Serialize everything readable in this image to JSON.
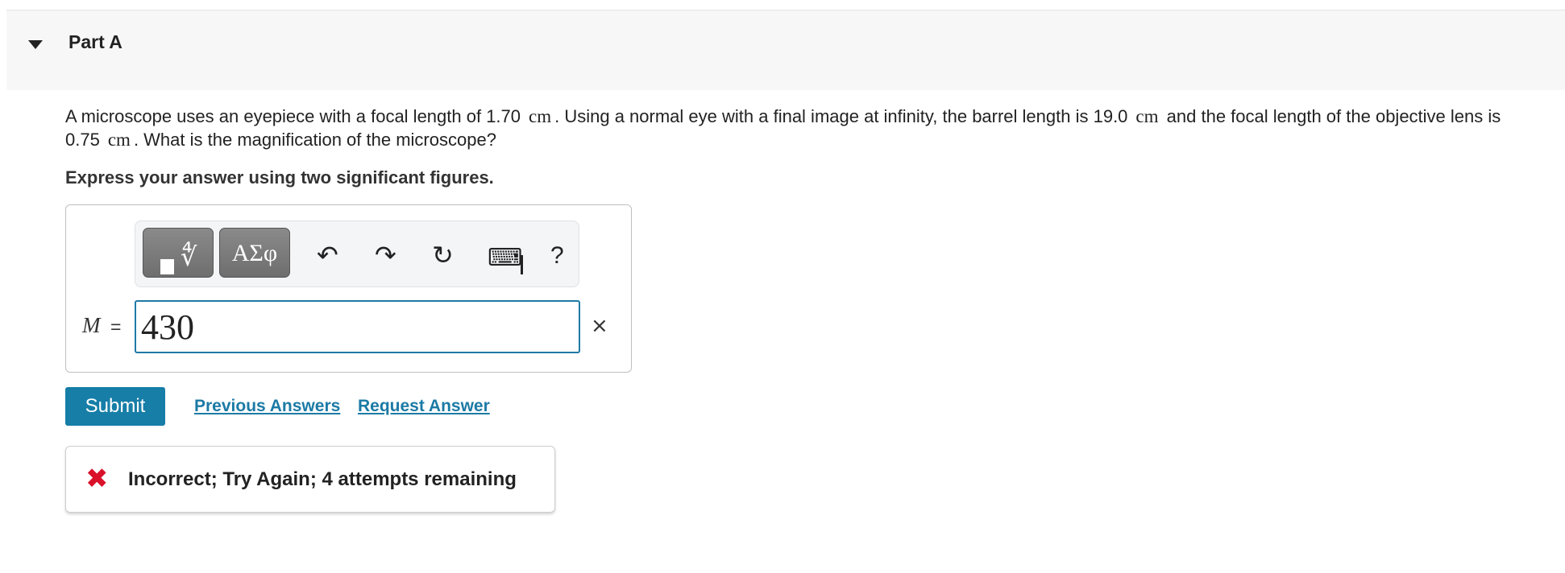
{
  "part": {
    "title": "Part A",
    "expand_icon": "caret-down-icon"
  },
  "question": {
    "segment1": "A microscope uses an eyepiece with a focal length of 1.70",
    "unit1": "cm",
    "segment2": ". Using a normal eye with a final image at infinity, the barrel length is 19.0",
    "unit2": "cm",
    "segment3": "and the focal length of the objective lens is 0.75",
    "unit3": "cm",
    "segment4": ". What is the magnification of the microscope?"
  },
  "instruction": "Express your answer using two significant figures.",
  "toolbar": {
    "templates_icon": "templates-sqrt-icon",
    "symbols_label": "ΑΣφ",
    "undo_icon": "undo-icon",
    "redo_icon": "redo-icon",
    "reset_icon": "reset-icon",
    "keyboard_icon": "keyboard-icon",
    "help_label": "?"
  },
  "answer": {
    "variable": "M",
    "equals": "=",
    "value": "430",
    "clear_symbol": "×"
  },
  "actions": {
    "submit_label": "Submit",
    "previous_answers_label": "Previous Answers",
    "request_answer_label": "Request Answer"
  },
  "feedback": {
    "icon": "incorrect-x-icon",
    "message": "Incorrect; Try Again; 4 attempts remaining",
    "color": "#d9112a"
  },
  "colors": {
    "accent": "#167ea7",
    "link": "#1c7aa5",
    "input_border": "#1e7aa6"
  }
}
